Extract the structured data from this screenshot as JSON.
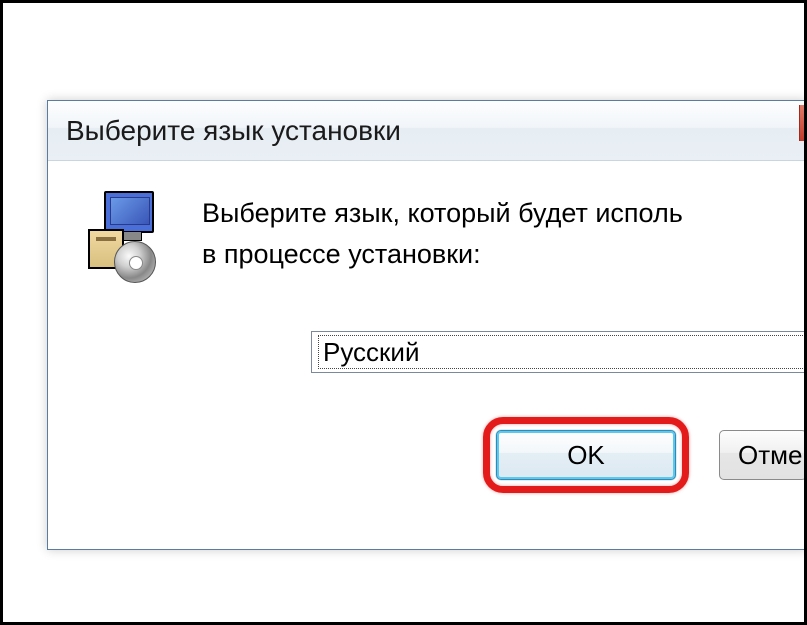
{
  "dialog": {
    "title": "Выберите язык установки",
    "message_line1": "Выберите язык, который будет исполь",
    "message_line2": "в  процессе установки:",
    "selected_language": "Русский",
    "ok_label": "OK",
    "cancel_label": "Отме"
  }
}
